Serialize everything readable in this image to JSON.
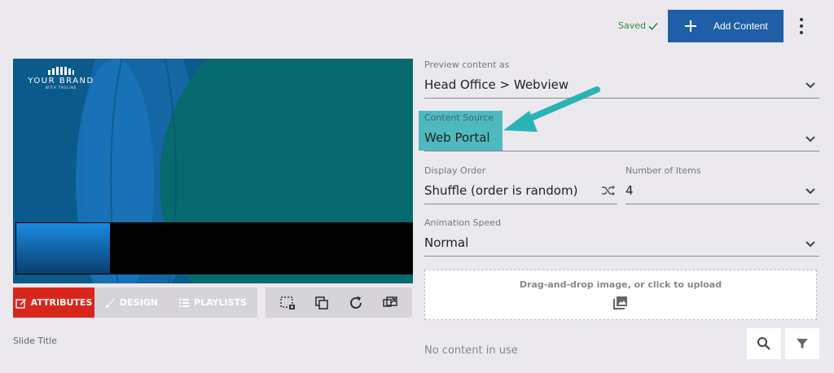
{
  "header": {
    "saved_label": "Saved",
    "add_content_label": "Add Content"
  },
  "preview": {
    "brand_name": "YOUR BRAND",
    "brand_tagline": "WITH TAGLINE"
  },
  "tabs": [
    {
      "label": "ATTRIBUTES",
      "icon": "edit-icon",
      "active": true
    },
    {
      "label": "DESIGN",
      "icon": "brush-icon",
      "active": false
    },
    {
      "label": "PLAYLISTS",
      "icon": "list-icon",
      "active": false
    }
  ],
  "tools": [
    "select-region-icon",
    "layers-icon",
    "refresh-icon",
    "resize-icon"
  ],
  "slide_title_label": "Slide Title",
  "form": {
    "preview_as": {
      "label": "Preview content as",
      "value": "Head Office > Webview"
    },
    "content_source": {
      "label": "Content Source",
      "value": "Web Portal"
    },
    "display_order": {
      "label": "Display Order",
      "value": "Shuffle (order is random)"
    },
    "number_of_items": {
      "label": "Number of Items",
      "value": "4"
    },
    "animation_speed": {
      "label": "Animation Speed",
      "value": "Normal"
    }
  },
  "dropzone": {
    "text": "Drag-and-drop image, or click to upload"
  },
  "no_content_text": "No content in use",
  "colors": {
    "accent_blue": "#1f5fa8",
    "tab_active_red": "#d9261c",
    "highlight_teal": "#4fb9c0",
    "saved_green": "#2e8b3a"
  }
}
